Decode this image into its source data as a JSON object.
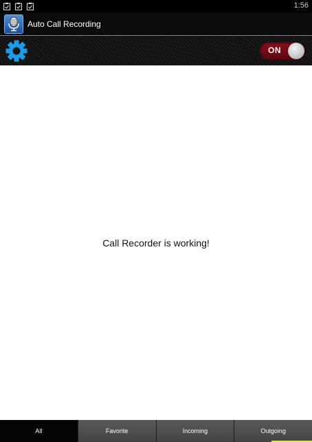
{
  "status_bar": {
    "time": "1:56",
    "notification_icons": [
      "clipboard-icon",
      "clipboard-icon",
      "clipboard-icon"
    ]
  },
  "action_bar": {
    "app_icon": "microphone-icon",
    "title": "Auto Call Recording"
  },
  "toolbar": {
    "settings_icon": "gear-icon",
    "toggle_label": "ON",
    "toggle_state": true,
    "accent_color": "#1e9be6"
  },
  "main": {
    "status_message": "Call Recorder is working!"
  },
  "tabs": [
    {
      "label": "All",
      "active": true
    },
    {
      "label": "Favorite",
      "active": false
    },
    {
      "label": "Incoming",
      "active": false
    },
    {
      "label": "Outgoing",
      "active": false
    }
  ]
}
